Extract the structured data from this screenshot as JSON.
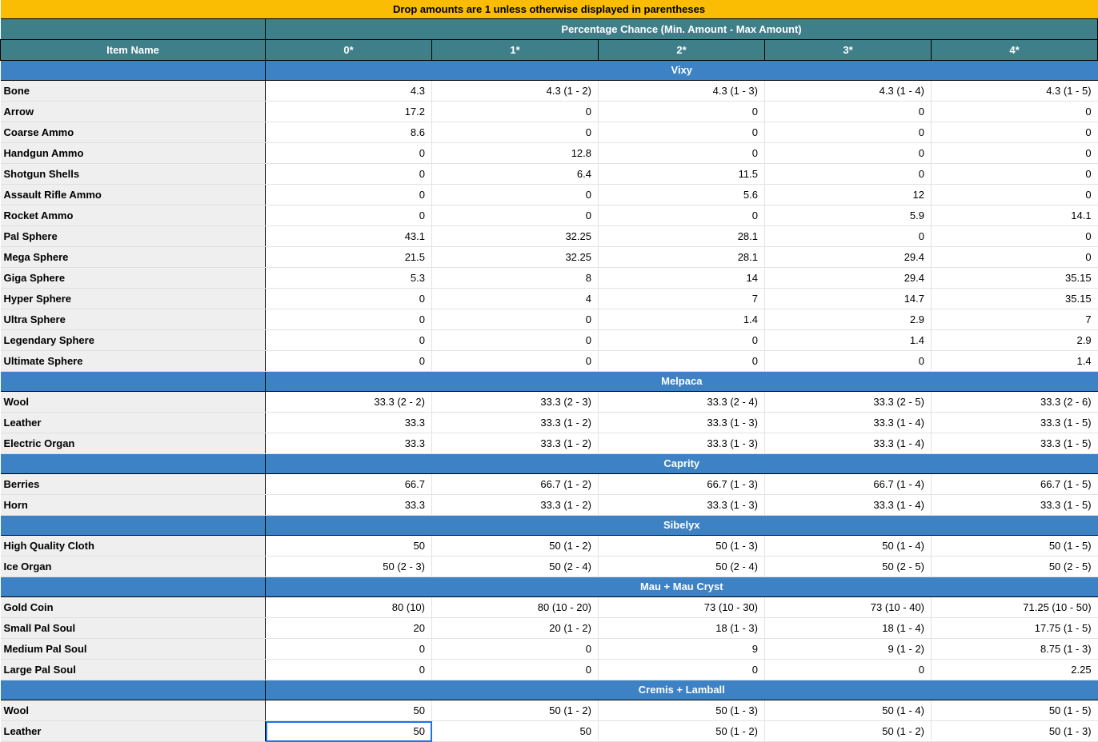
{
  "banner": {
    "note": "Drop amounts are 1 unless otherwise displayed in parentheses"
  },
  "header": {
    "group_title": "Percentage Chance (Min. Amount - Max Amount)",
    "item_name_label": "Item Name",
    "columns": [
      "0*",
      "1*",
      "2*",
      "3*",
      "4*"
    ]
  },
  "colors": {
    "banner_bg": "#fbbc04",
    "header_bg": "#3f7f8a",
    "group_bg": "#3c82c4",
    "item_col_bg": "#efefef",
    "selection": "#1a73e8"
  },
  "chart_data": {
    "type": "table",
    "title": "Percentage Chance (Min. Amount - Max Amount)",
    "note": "Drop amounts are 1 unless otherwise displayed in parentheses",
    "columns": [
      "Item Name",
      "0*",
      "1*",
      "2*",
      "3*",
      "4*"
    ],
    "groups": [
      {
        "name": "Vixy",
        "rows": [
          {
            "item": "Bone",
            "values": [
              "4.3",
              "4.3 (1 - 2)",
              "4.3 (1 - 3)",
              "4.3 (1 - 4)",
              "4.3 (1 - 5)"
            ]
          },
          {
            "item": "Arrow",
            "values": [
              "17.2",
              "0",
              "0",
              "0",
              "0"
            ]
          },
          {
            "item": "Coarse Ammo",
            "values": [
              "8.6",
              "0",
              "0",
              "0",
              "0"
            ]
          },
          {
            "item": "Handgun Ammo",
            "values": [
              "0",
              "12.8",
              "0",
              "0",
              "0"
            ]
          },
          {
            "item": "Shotgun Shells",
            "values": [
              "0",
              "6.4",
              "11.5",
              "0",
              "0"
            ]
          },
          {
            "item": "Assault Rifle Ammo",
            "values": [
              "0",
              "0",
              "5.6",
              "12",
              "0"
            ]
          },
          {
            "item": "Rocket Ammo",
            "values": [
              "0",
              "0",
              "0",
              "5.9",
              "14.1"
            ]
          },
          {
            "item": "Pal Sphere",
            "values": [
              "43.1",
              "32.25",
              "28.1",
              "0",
              "0"
            ]
          },
          {
            "item": "Mega Sphere",
            "values": [
              "21.5",
              "32.25",
              "28.1",
              "29.4",
              "0"
            ]
          },
          {
            "item": "Giga Sphere",
            "values": [
              "5.3",
              "8",
              "14",
              "29.4",
              "35.15"
            ]
          },
          {
            "item": "Hyper Sphere",
            "values": [
              "0",
              "4",
              "7",
              "14.7",
              "35.15"
            ]
          },
          {
            "item": "Ultra Sphere",
            "values": [
              "0",
              "0",
              "1.4",
              "2.9",
              "7"
            ]
          },
          {
            "item": "Legendary Sphere",
            "values": [
              "0",
              "0",
              "0",
              "1.4",
              "2.9"
            ]
          },
          {
            "item": "Ultimate Sphere",
            "values": [
              "0",
              "0",
              "0",
              "0",
              "1.4"
            ]
          }
        ]
      },
      {
        "name": "Melpaca",
        "rows": [
          {
            "item": "Wool",
            "values": [
              "33.3 (2 - 2)",
              "33.3 (2 - 3)",
              "33.3 (2 - 4)",
              "33.3 (2 - 5)",
              "33.3 (2 - 6)"
            ]
          },
          {
            "item": "Leather",
            "values": [
              "33.3",
              "33.3 (1 - 2)",
              "33.3 (1 - 3)",
              "33.3 (1 - 4)",
              "33.3 (1 - 5)"
            ]
          },
          {
            "item": "Electric Organ",
            "values": [
              "33.3",
              "33.3 (1 - 2)",
              "33.3  (1 - 3)",
              "33.3 (1 - 4)",
              "33.3 (1 - 5)"
            ]
          }
        ]
      },
      {
        "name": "Caprity",
        "rows": [
          {
            "item": "Berries",
            "values": [
              "66.7",
              "66.7 (1 - 2)",
              "66.7 (1 - 3)",
              "66.7 (1 - 4)",
              "66.7 (1 - 5)"
            ]
          },
          {
            "item": "Horn",
            "values": [
              "33.3",
              "33.3 (1 - 2)",
              "33.3 (1 - 3)",
              "33.3 (1 - 4)",
              "33.3 (1 - 5)"
            ]
          }
        ]
      },
      {
        "name": "Sibelyx",
        "rows": [
          {
            "item": "High Quality Cloth",
            "values": [
              "50",
              "50 (1 - 2)",
              "50 (1 - 3)",
              "50 (1 - 4)",
              "50 (1 - 5)"
            ]
          },
          {
            "item": "Ice Organ",
            "values": [
              "50 (2 - 3)",
              "50 (2 - 4)",
              "50 (2 - 4)",
              "50 (2 - 5)",
              "50 (2 - 5)"
            ]
          }
        ]
      },
      {
        "name": "Mau + Mau Cryst",
        "rows": [
          {
            "item": "Gold Coin",
            "values": [
              "80 (10)",
              "80 (10 - 20)",
              "73 (10 - 30)",
              "73 (10 - 40)",
              "71.25 (10 - 50)"
            ]
          },
          {
            "item": "Small Pal Soul",
            "values": [
              "20",
              "20 (1 - 2)",
              "18 (1 - 3)",
              "18 (1 - 4)",
              "17.75 (1 - 5)"
            ]
          },
          {
            "item": "Medium Pal Soul",
            "values": [
              "0",
              "0",
              "9",
              "9 (1 - 2)",
              "8.75 (1 - 3)"
            ]
          },
          {
            "item": "Large Pal Soul",
            "values": [
              "0",
              "0",
              "0",
              "0",
              "2.25"
            ]
          }
        ]
      },
      {
        "name": "Cremis + Lamball",
        "rows": [
          {
            "item": "Wool",
            "values": [
              "50",
              "50 (1 - 2)",
              "50 (1 - 3)",
              "50 (1 - 4)",
              "50 (1 - 5)"
            ]
          },
          {
            "item": "Leather",
            "values": [
              "50",
              "50",
              "50 (1 - 2)",
              "50 (1 - 2)",
              "50 (1 - 3)"
            ]
          }
        ]
      }
    ]
  }
}
